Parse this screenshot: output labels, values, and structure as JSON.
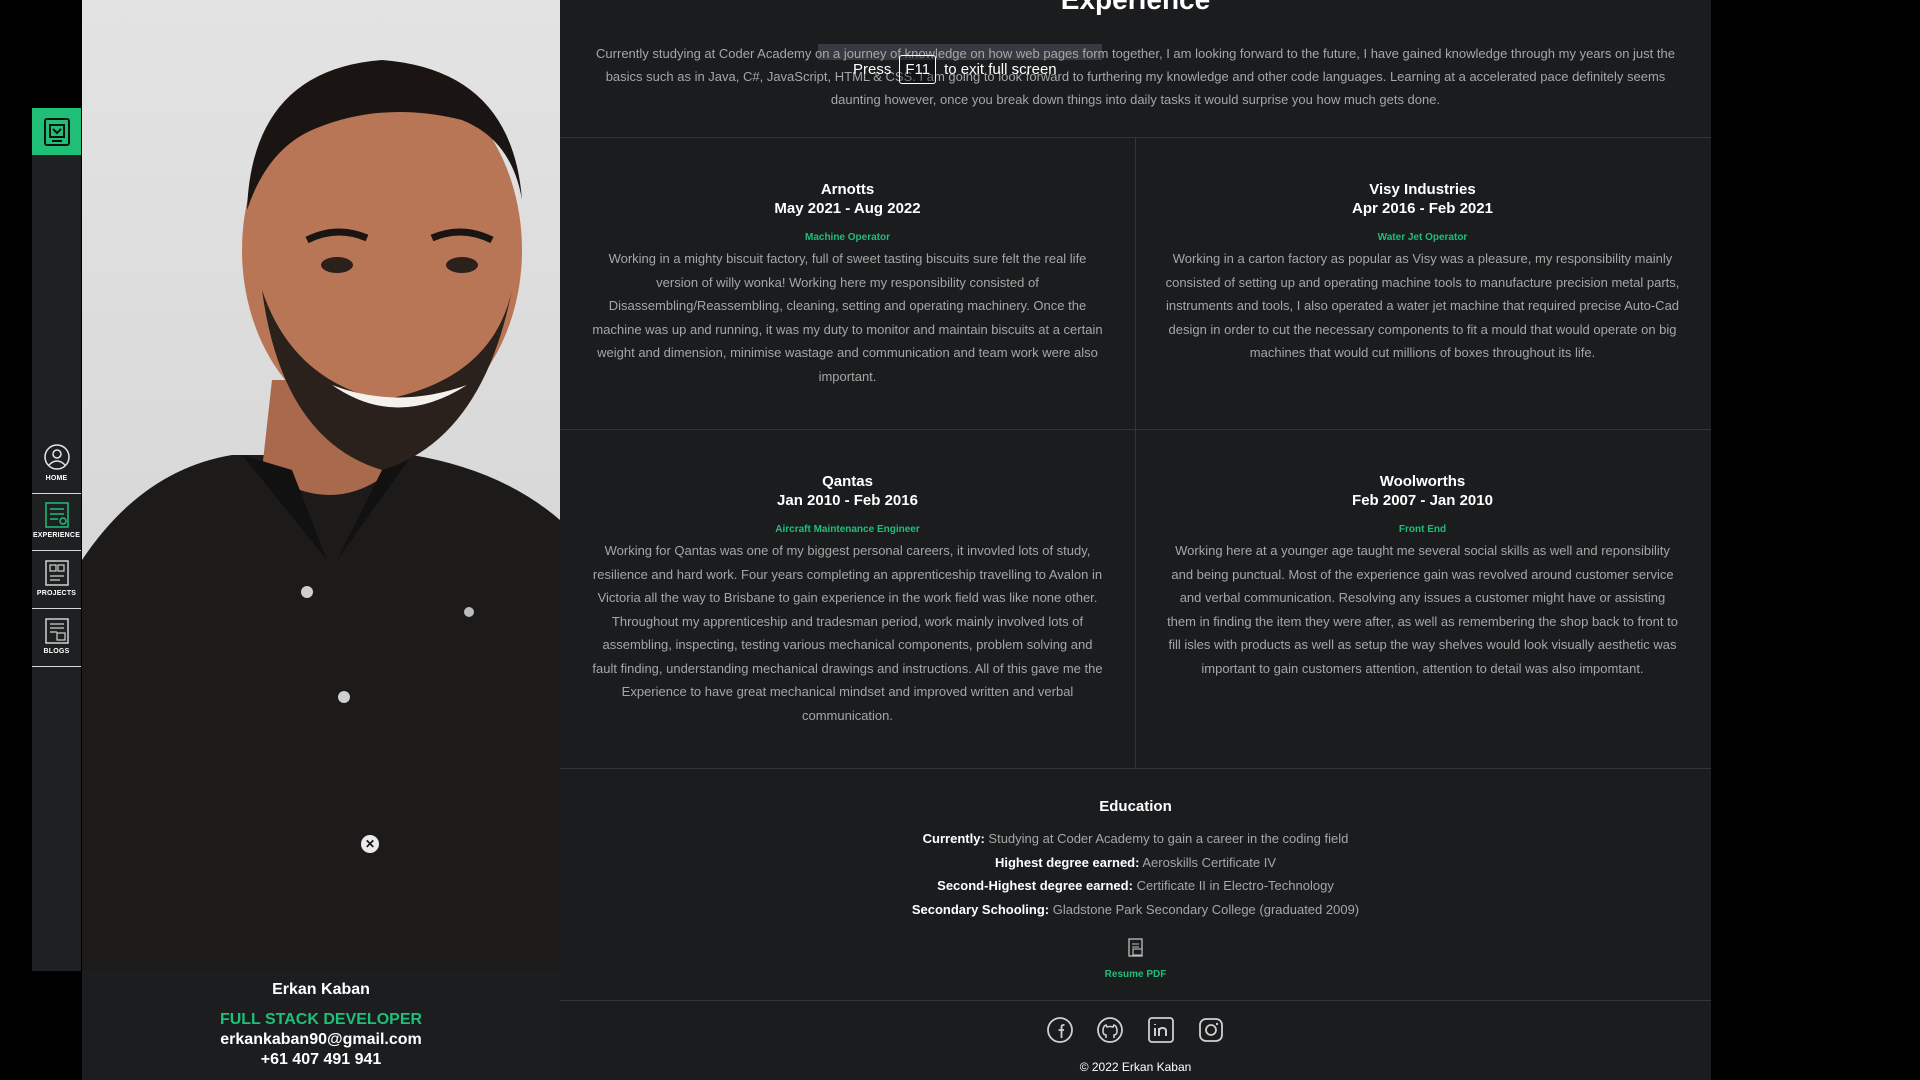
{
  "nav": {
    "items": [
      {
        "label": "HOME"
      },
      {
        "label": "EXPERIENCE"
      },
      {
        "label": "PROJECTS"
      },
      {
        "label": "BLOGS"
      }
    ]
  },
  "profile": {
    "name": "Erkan Kaban",
    "role": "FULL STACK DEVELOPER",
    "email": "erkankaban90@gmail.com",
    "phone": "+61 407 491 941"
  },
  "section": {
    "title": "Experience",
    "intro": "Currently studying at Coder Academy on a journey of knowledge on how web pages form together, I am looking forward to the future, I have gained knowledge through my years on just the basics such as in Java, C#, JavaScript, HTML & CSS. I am going to look forward to furthering my knowledge and other code languages. Learning at a accelerated pace definitely seems daunting however, once you break down things into daily tasks it would surprise you how much gets done."
  },
  "jobs": [
    {
      "company": "Arnotts",
      "dates": "May 2021 - Aug 2022",
      "title": "Machine Operator",
      "desc": "Working in a mighty biscuit factory, full of sweet tasting biscuits sure felt the real life version of willy wonka! Working here my responsibility consisted of Disassembling/Reassembling, cleaning, setting and operating machinery. Once the machine was up and running, it was my duty to monitor and maintain biscuits at a certain weight and dimension, minimise wastage and communication and team work were also important."
    },
    {
      "company": "Visy Industries",
      "dates": "Apr 2016 - Feb 2021",
      "title": "Water Jet Operator",
      "desc": "Working in a carton factory as popular as Visy was a pleasure, my responsibility mainly consisted of setting up and operating machine tools to manufacture precision metal parts, instruments and tools, I also operated a water jet machine that required precise Auto-Cad design in order to cut the necessary components to fit a mould that would operate on big machines that would cut millions of boxes throughout its life."
    },
    {
      "company": "Qantas",
      "dates": "Jan 2010 - Feb 2016",
      "title": "Aircraft Maintenance Engineer",
      "desc": "Working for Qantas was one of my biggest personal careers, it invovled lots of study, resilience and hard work. Four years completing an apprenticeship travelling to Avalon in Victoria all the way to Brisbane to gain experience in the work field was like none other. Throughout my apprenticeship and tradesman period, work mainly involved lots of assembling, inspecting, testing various mechanical components, problem solving and fault finding, understanding mechanical drawings and instructions. All of this gave me the Experience to have great mechanical mindset and improved written and verbal communication."
    },
    {
      "company": "Woolworths",
      "dates": "Feb 2007 - Jan 2010",
      "title": "Front End",
      "desc": "Working here at a younger age taught me several social skills as well and reponsibility and being punctual. Most of the experience gain was revolved around customer service and verbal communication. Resolving any issues a customer might have or assisting them in finding the item they were after, as well as remembering the shop back to front to fill isles with products as well as setup the way shelves would look visually aesthetic was important to gain customers attention, attention to detail was also impomtant."
    }
  ],
  "education": {
    "heading": "Education",
    "rows": [
      {
        "label": "Currently:",
        "value": "Studying at Coder Academy to gain a career in the coding field"
      },
      {
        "label": "Highest degree earned:",
        "value": "Aeroskills Certificate IV"
      },
      {
        "label": "Second-Highest degree earned:",
        "value": "Certificate II in Electro-Technology"
      },
      {
        "label": "Secondary Schooling:",
        "value": "Gladstone Park Secondary College (graduated 2009)"
      }
    ],
    "resume_label": "Resume PDF"
  },
  "footer": {
    "social": [
      "facebook-icon",
      "github-icon",
      "linkedin-icon",
      "instagram-icon"
    ],
    "copyright": "© 2022 Erkan Kaban"
  },
  "toast": {
    "press": "Press",
    "key": "F11",
    "suffix": "to exit full screen"
  },
  "colors": {
    "accent": "#1fbf78",
    "panel": "#1a1c1e",
    "text_muted": "#a6a6a6"
  }
}
